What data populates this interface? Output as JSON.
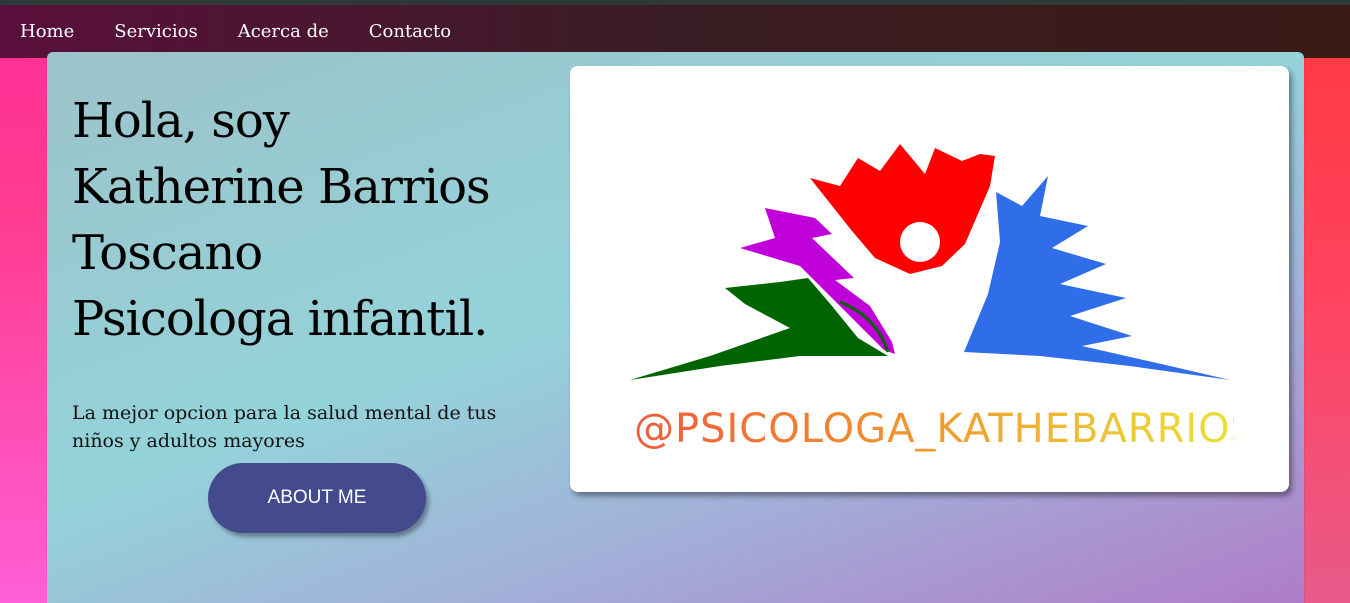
{
  "nav": {
    "items": [
      {
        "label": "Home"
      },
      {
        "label": "Servicios"
      },
      {
        "label": "Acerca de"
      },
      {
        "label": "Contacto"
      }
    ]
  },
  "hero": {
    "heading_lines": [
      "Hola, soy",
      "Katherine Barrios",
      "Toscano",
      "Psicologa infantil."
    ],
    "subtitle": "La mejor opcion para la salud mental de tus niños y adultos mayores",
    "button_label": "ABOUT ME"
  },
  "logo": {
    "caption": "@PSICOLOGA_KATHEBARRIOS",
    "colors": {
      "red": "#ff0000",
      "purple": "#c000d8",
      "blue": "#2f6ee8",
      "green": "#006400"
    }
  }
}
